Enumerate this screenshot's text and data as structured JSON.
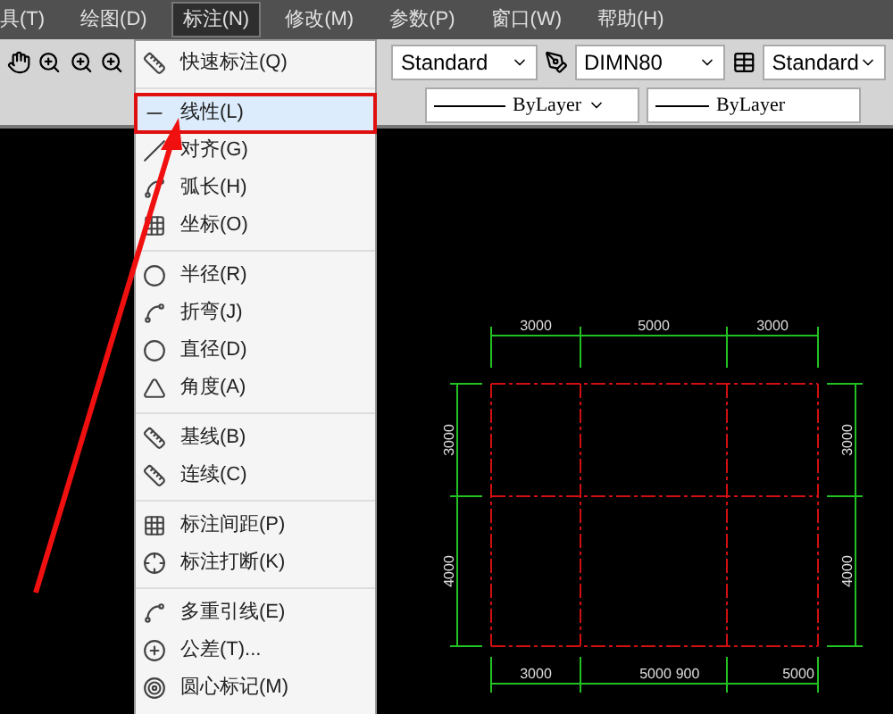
{
  "menu_bar": [
    {
      "label": "具(T)",
      "selected": false
    },
    {
      "label": "绘图(D)",
      "selected": false
    },
    {
      "label": "标注(N)",
      "selected": true
    },
    {
      "label": "修改(M)",
      "selected": false
    },
    {
      "label": "参数(P)",
      "selected": false
    },
    {
      "label": "窗口(W)",
      "selected": false
    },
    {
      "label": "帮助(H)",
      "selected": false
    }
  ],
  "toolbar": {
    "text_style": "Standard",
    "dim_style": "DIMN80",
    "table_style": "Standard"
  },
  "properties_bar": {
    "linetype": "ByLayer",
    "lineweight": "ByLayer"
  },
  "dimension_menu": [
    {
      "items": [
        {
          "label": "快速标注(Q)",
          "selected": false
        }
      ]
    },
    {
      "items": [
        {
          "label": "线性(L)",
          "selected": true
        },
        {
          "label": "对齐(G)",
          "selected": false
        },
        {
          "label": "弧长(H)",
          "selected": false
        },
        {
          "label": "坐标(O)",
          "selected": false
        }
      ]
    },
    {
      "items": [
        {
          "label": "半径(R)",
          "selected": false
        },
        {
          "label": "折弯(J)",
          "selected": false
        },
        {
          "label": "直径(D)",
          "selected": false
        },
        {
          "label": "角度(A)",
          "selected": false
        }
      ]
    },
    {
      "items": [
        {
          "label": "基线(B)",
          "selected": false
        },
        {
          "label": "连续(C)",
          "selected": false
        }
      ]
    },
    {
      "items": [
        {
          "label": "标注间距(P)",
          "selected": false
        },
        {
          "label": "标注打断(K)",
          "selected": false
        }
      ]
    },
    {
      "items": [
        {
          "label": "多重引线(E)",
          "selected": false
        },
        {
          "label": "公差(T)...",
          "selected": false
        },
        {
          "label": "圆心标记(M)",
          "selected": false
        }
      ]
    }
  ],
  "drawing": {
    "top_dims": [
      "3000",
      "5000",
      "3000"
    ],
    "left_dims": [
      "3000",
      "4000"
    ],
    "right_dims": [
      "3000",
      "4000"
    ],
    "bottom_dims": [
      "3000",
      "5000",
      "900",
      "5000"
    ]
  }
}
